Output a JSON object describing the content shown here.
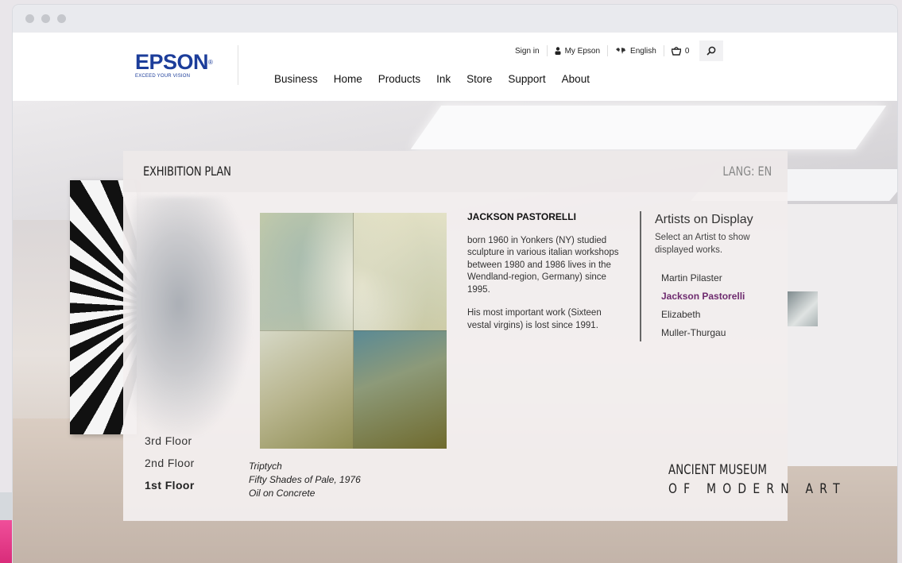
{
  "header": {
    "logo_word": "EPSON",
    "logo_tagline": "EXCEED YOUR VISION",
    "utility": {
      "sign_in": "Sign in",
      "my_epson": "My Epson",
      "language": "English",
      "cart_count": "0"
    },
    "nav": [
      "Business",
      "Home",
      "Products",
      "Ink",
      "Store",
      "Support",
      "About"
    ]
  },
  "panel": {
    "title": "EXHIBITION PLAN",
    "lang": "LANG: EN",
    "floors": [
      {
        "label": "3rd Floor",
        "active": false
      },
      {
        "label": "2nd Floor",
        "active": false
      },
      {
        "label": "1st Floor",
        "active": true
      }
    ],
    "artwork_caption": [
      "Triptych",
      "Fifty Shades of Pale, 1976",
      "Oil on Concrete"
    ],
    "bio": {
      "name": "JACKSON PASTORELLI",
      "paragraph1": "born 1960 in Yonkers (NY) studied sculpture in various italian workshops between 1980 and 1986 lives in the Wendland-region, Germany) since 1995.",
      "paragraph2": "His most important work (Sixteen vestal virgins) is lost since 1991."
    },
    "artists_title": "Artists on Display",
    "artists_subtitle": "Select an Artist to show displayed works.",
    "artists": [
      {
        "name": "Martin Pilaster",
        "active": false
      },
      {
        "name": "Jackson Pastorelli",
        "active": true
      },
      {
        "name": "Elizabeth",
        "active": false
      },
      {
        "name": "Muller-Thurgau",
        "active": false
      }
    ],
    "museum_line1": "ANCIENT MUSEUM",
    "museum_line2": "OF MODERN ART"
  },
  "colors": {
    "brand_blue": "#1c3d9a",
    "active_artist": "#6e2b6f",
    "accent_pink": "#e23b8a"
  },
  "icons": [
    "user-icon",
    "globe-icon",
    "cart-icon",
    "search-icon"
  ]
}
